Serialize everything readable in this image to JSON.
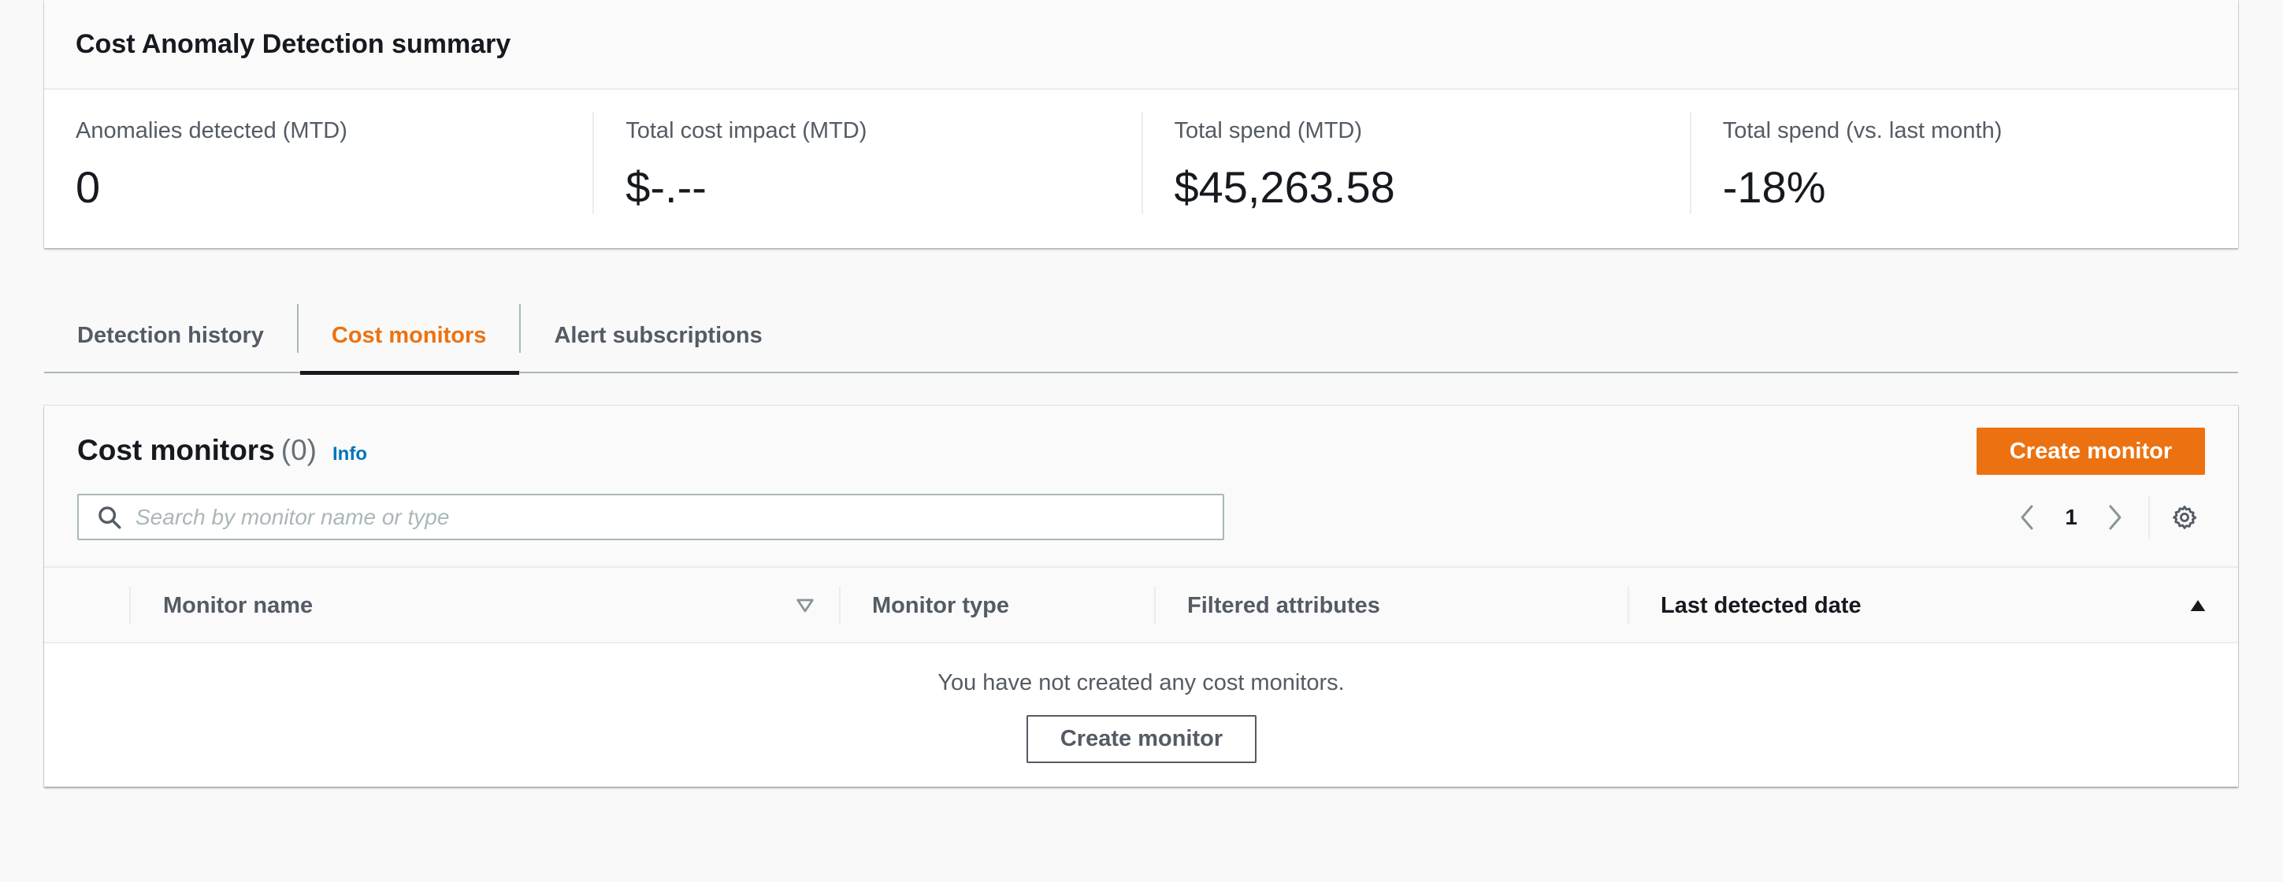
{
  "summary": {
    "title": "Cost Anomaly Detection summary",
    "metrics": [
      {
        "label": "Anomalies detected (MTD)",
        "value": "0"
      },
      {
        "label": "Total cost impact (MTD)",
        "value": "$-.--"
      },
      {
        "label": "Total spend (MTD)",
        "value": "$45,263.58"
      },
      {
        "label": "Total spend (vs. last month)",
        "value": "-18%"
      }
    ]
  },
  "tabs": [
    {
      "label": "Detection history",
      "active": false
    },
    {
      "label": "Cost monitors",
      "active": true
    },
    {
      "label": "Alert subscriptions",
      "active": false
    }
  ],
  "panel": {
    "title": "Cost monitors",
    "count": "(0)",
    "info_link": "Info",
    "create_button": "Create monitor",
    "search": {
      "value": "",
      "placeholder": "Search by monitor name or type"
    },
    "pagination": {
      "current_page": "1"
    },
    "table": {
      "columns": [
        "Monitor name",
        "Monitor type",
        "Filtered attributes",
        "Last detected date"
      ],
      "sorted_column": "Last detected date",
      "sort_direction": "ascending"
    },
    "empty_state": {
      "message": "You have not created any cost monitors.",
      "button": "Create monitor"
    }
  },
  "icons": {
    "search": "search-icon",
    "prev": "chevron-left-icon",
    "next": "chevron-right-icon",
    "settings": "gear-icon",
    "sort_default": "sort-caret-down-outline-icon",
    "sort_active": "sort-caret-up-filled-icon"
  },
  "colors": {
    "accent": "#ec7211",
    "link": "#0073bb",
    "text": "#16191f",
    "muted": "#545b64",
    "background": "#f9f9f9"
  }
}
